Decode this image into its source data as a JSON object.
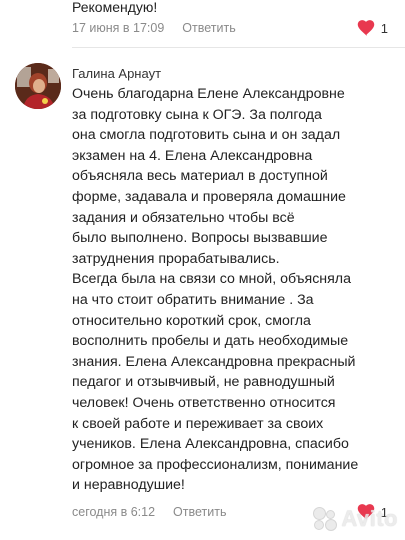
{
  "previous_review": {
    "text_tail": "Рекомендую!",
    "date": "17 июня в 17:09",
    "reply_label": "Ответить",
    "likes": "1"
  },
  "review": {
    "author": "Галина Арнаут",
    "text": "Очень благодарна Елене Александровне\nза подготовку сына к ОГЭ. За полгода\nона смогла подготовить сына и он задал\nэкзамен на 4. Елена Александровна\nобъясняла весь материал в доступной\nформе, задавала и проверяла домашние\nзадания и обязательно чтобы всё\nбыло выполнено. Вопросы вызвавшие\nзатруднения прорабатывались.\nВсегда была на связи со мной, объясняла\nна что стоит обратить внимание .  За\nотносительно короткий срок, смогла\nвосполнить пробелы и дать необходимые\nзнания. Елена Александровна прекрасный\nпедагог и отзывчивый, не равнодушный\nчеловек! Очень ответственно относится\nк своей работе и переживает за своих\nучеников. Елена Александровна, спасибо\nогромное за профессионализм, понимание\nи неравнодушие!",
    "date": "сегодня в 6:12",
    "reply_label": "Ответить",
    "likes": "1"
  },
  "watermark": {
    "text": "Avito"
  },
  "colors": {
    "heart": "#e8384f",
    "meta_text": "#8a8a8a",
    "divider": "#e6e6e6"
  },
  "icons": {
    "like": "heart-icon",
    "avatar": "avatar"
  }
}
